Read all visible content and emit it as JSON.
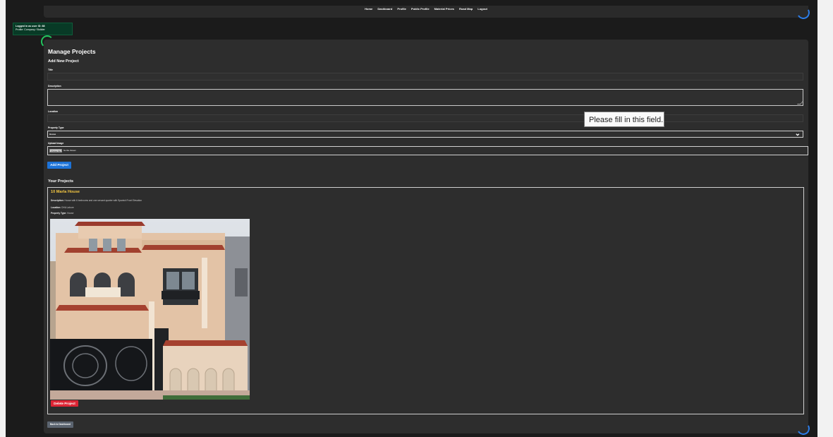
{
  "nav": {
    "links": [
      "Home",
      "Dashboard",
      "Profile",
      "Public Profile",
      "Material Prices",
      "Road Map",
      "Logout"
    ]
  },
  "login_notice": {
    "line1": "Logged in as user ID: 88",
    "line2": "Profile: Company / Builder"
  },
  "page": {
    "title": "Manage Projects",
    "form_heading": "Add New Project"
  },
  "form": {
    "title_label": "Title",
    "title_value": "",
    "description_label": "Description",
    "description_value": "",
    "location_label": "Location",
    "location_value": "",
    "property_type_label": "Property Type",
    "property_type_value": "House",
    "image_label": "Upload Image",
    "file_button": "Choose File",
    "file_status": "No file chosen",
    "submit_label": "Add Project"
  },
  "validation_tooltip": "Please fill in this field.",
  "projects": {
    "heading": "Your Projects",
    "items": [
      {
        "title": "10 Marla House",
        "description_label": "Description:",
        "description": "House with 6 bedrooms and one servant quarter with Spanish Front Elevation",
        "location_label": "Location:",
        "location": "DHA Lahore",
        "type_label": "Property Type:",
        "type": "House",
        "delete_label": "Delete Project"
      }
    ]
  },
  "back_label": "Back to Dashboard",
  "colors": {
    "page_bg": "#1b1b1b",
    "panel_bg": "#2d2d2d",
    "primary": "#1d73d8",
    "danger": "#dc2535",
    "accent_title": "#f5c842",
    "notice_bg": "#083a26",
    "spinner_green": "#22c55e",
    "spinner_blue": "#2b7de9"
  }
}
